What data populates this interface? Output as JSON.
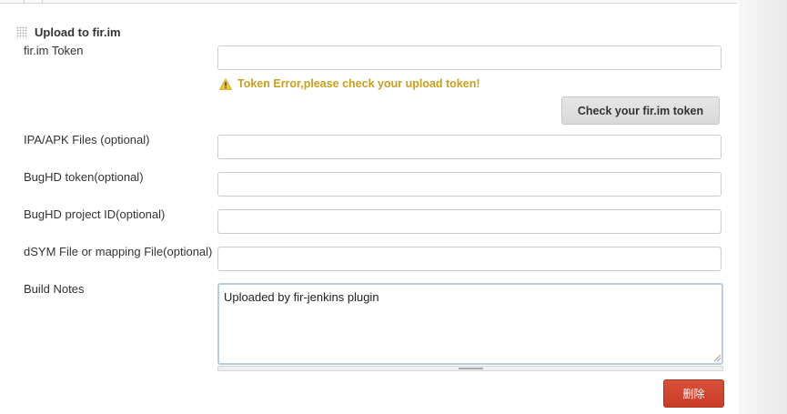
{
  "section": {
    "title": "Upload to fir.im"
  },
  "fields": {
    "token": {
      "label": "fir.im Token",
      "value": ""
    },
    "ipa_apk": {
      "label": "IPA/APK Files (optional)",
      "value": ""
    },
    "bughd_token": {
      "label": "BugHD token(optional)",
      "value": ""
    },
    "bughd_project": {
      "label": "BugHD project ID(optional)",
      "value": ""
    },
    "dsym": {
      "label": "dSYM File or mapping File(optional)",
      "value": ""
    },
    "build_notes": {
      "label": "Build Notes",
      "value": "Uploaded by fir-jenkins plugin"
    }
  },
  "warning": {
    "icon": "warning-triangle-icon",
    "text": "Token Error,please check your upload token!"
  },
  "buttons": {
    "check_token": "Check your fir.im token",
    "delete": "删除"
  },
  "colors": {
    "warning": "#c8a01a",
    "delete_button": "#d04a35",
    "textarea_focus_border": "#b7cde6"
  }
}
